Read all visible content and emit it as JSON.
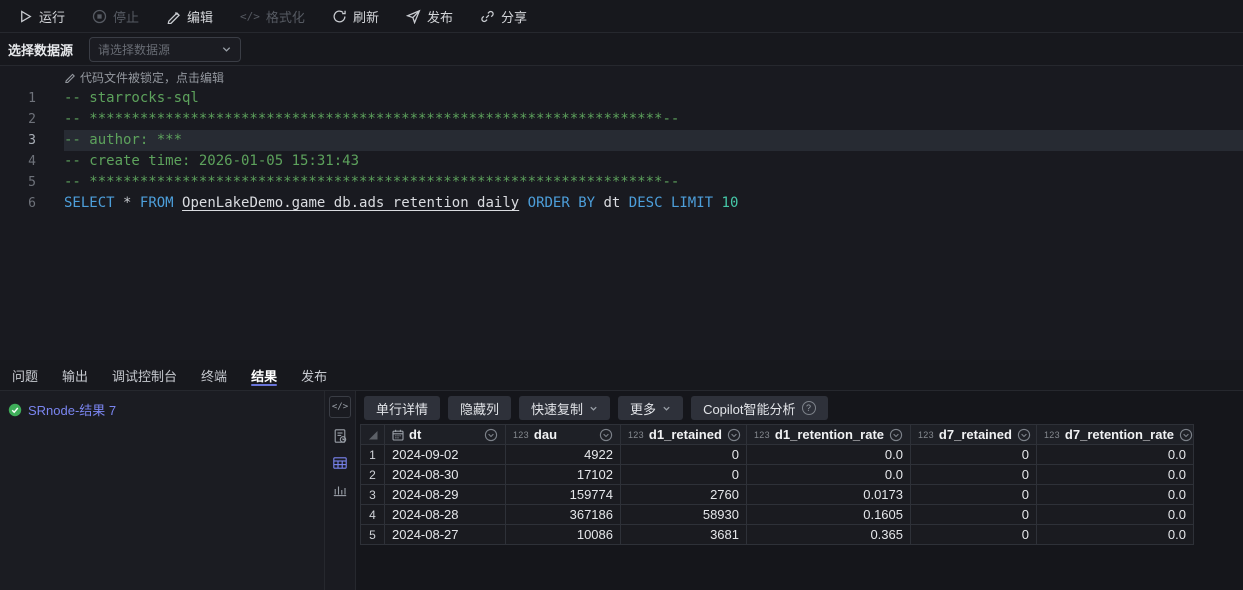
{
  "toolbar": {
    "run": "运行",
    "stop": "停止",
    "edit": "编辑",
    "format": "格式化",
    "refresh": "刷新",
    "publish": "发布",
    "share": "分享"
  },
  "datasource": {
    "label": "选择数据源",
    "placeholder": "请选择数据源"
  },
  "editor": {
    "lock_notice": "代码文件被锁定，点击编辑",
    "lines": [
      {
        "num": "1",
        "highlight": false,
        "segments": [
          {
            "c": "comment",
            "t": "-- starrocks-sql"
          }
        ]
      },
      {
        "num": "2",
        "highlight": false,
        "segments": [
          {
            "c": "comment",
            "t": "-- ********************************************************************--"
          }
        ]
      },
      {
        "num": "3",
        "highlight": true,
        "segments": [
          {
            "c": "comment",
            "t": "-- author: ***"
          }
        ]
      },
      {
        "num": "4",
        "highlight": false,
        "segments": [
          {
            "c": "comment",
            "t": "-- create time: 2026-01-05 15:31:43"
          }
        ]
      },
      {
        "num": "5",
        "highlight": false,
        "segments": [
          {
            "c": "comment",
            "t": "-- ********************************************************************--"
          }
        ]
      },
      {
        "num": "6",
        "highlight": false,
        "segments": [
          {
            "c": "keyword",
            "t": "SELECT"
          },
          {
            "c": "plain",
            "t": " "
          },
          {
            "c": "operator",
            "t": "*"
          },
          {
            "c": "plain",
            "t": " "
          },
          {
            "c": "keyword",
            "t": "FROM"
          },
          {
            "c": "plain",
            "t": " "
          },
          {
            "c": "table",
            "t": "OpenLakeDemo.game_db.ads_retention_daily"
          },
          {
            "c": "plain",
            "t": " "
          },
          {
            "c": "keyword",
            "t": "ORDER BY"
          },
          {
            "c": "plain",
            "t": " dt "
          },
          {
            "c": "keyword",
            "t": "DESC"
          },
          {
            "c": "plain",
            "t": " "
          },
          {
            "c": "keyword",
            "t": "LIMIT"
          },
          {
            "c": "plain",
            "t": " "
          },
          {
            "c": "number",
            "t": "10"
          }
        ]
      }
    ]
  },
  "panel": {
    "tabs": [
      {
        "label": "问题",
        "active": false
      },
      {
        "label": "输出",
        "active": false
      },
      {
        "label": "调试控制台",
        "active": false
      },
      {
        "label": "终端",
        "active": false
      },
      {
        "label": "结果",
        "active": true
      },
      {
        "label": "发布",
        "active": false
      }
    ]
  },
  "results": {
    "result_item": "SRnode-结果 7",
    "toolbar": {
      "row_detail": "单行详情",
      "hide_columns": "隐藏列",
      "quick_copy": "快速复制",
      "more": "更多",
      "copilot": "Copilot智能分析"
    },
    "table": {
      "columns": [
        {
          "name": "dt",
          "type": "date"
        },
        {
          "name": "dau",
          "type": "number"
        },
        {
          "name": "d1_retained",
          "type": "number"
        },
        {
          "name": "d1_retention_rate",
          "type": "number"
        },
        {
          "name": "d7_retained",
          "type": "number"
        },
        {
          "name": "d7_retention_rate",
          "type": "number"
        }
      ],
      "rows": [
        [
          "2024-09-02",
          "4922",
          "0",
          "0.0",
          "0",
          "0.0"
        ],
        [
          "2024-08-30",
          "17102",
          "0",
          "0.0",
          "0",
          "0.0"
        ],
        [
          "2024-08-29",
          "159774",
          "2760",
          "0.0173",
          "0",
          "0.0"
        ],
        [
          "2024-08-28",
          "367186",
          "58930",
          "0.1605",
          "0",
          "0.0"
        ],
        [
          "2024-08-27",
          "10086",
          "3681",
          "0.365",
          "0",
          "0.0"
        ]
      ]
    }
  },
  "icons": {
    "format_glyph": "</>",
    "code_view_glyph": "</>",
    "number_type": "123",
    "help_glyph": "?"
  },
  "colors": {
    "accent": "#6a75d8",
    "link": "#7a85f0",
    "success": "#3fae5a",
    "keyword": "#4d9fdb",
    "comment": "#5da25c",
    "number": "#45c8a8"
  }
}
